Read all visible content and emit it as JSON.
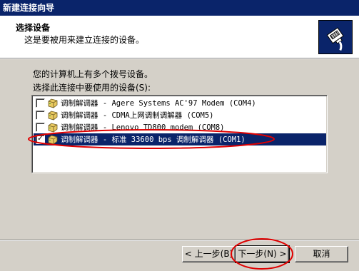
{
  "window": {
    "title": "新建连接向导"
  },
  "header": {
    "title": "选择设备",
    "subtitle": "这是要被用来建立连接的设备。"
  },
  "intro": "您的计算机上有多个拨号设备。",
  "list_label": "选择此连接中要使用的设备(S):",
  "devices": [
    {
      "label": "调制解调器 - Agere Systems AC'97 Modem (COM4)",
      "checked": false,
      "selected": false
    },
    {
      "label": "调制解调器 - CDMA上网调制调解器 (COM5)",
      "checked": false,
      "selected": false
    },
    {
      "label": "调制解调器 - Lenovo TD800 modem (COM8)",
      "checked": false,
      "selected": false
    },
    {
      "label": "调制解调器 - 标准 33600 bps 调制解调器 (COM1)",
      "checked": true,
      "selected": true
    }
  ],
  "buttons": {
    "back": "< 上一步(B)",
    "next": "下一步(N) >",
    "cancel": "取消"
  },
  "colors": {
    "titlebar": "#0a246a",
    "selection": "#0a246a",
    "annotation": "#e00000",
    "face": "#d4d0c8"
  }
}
